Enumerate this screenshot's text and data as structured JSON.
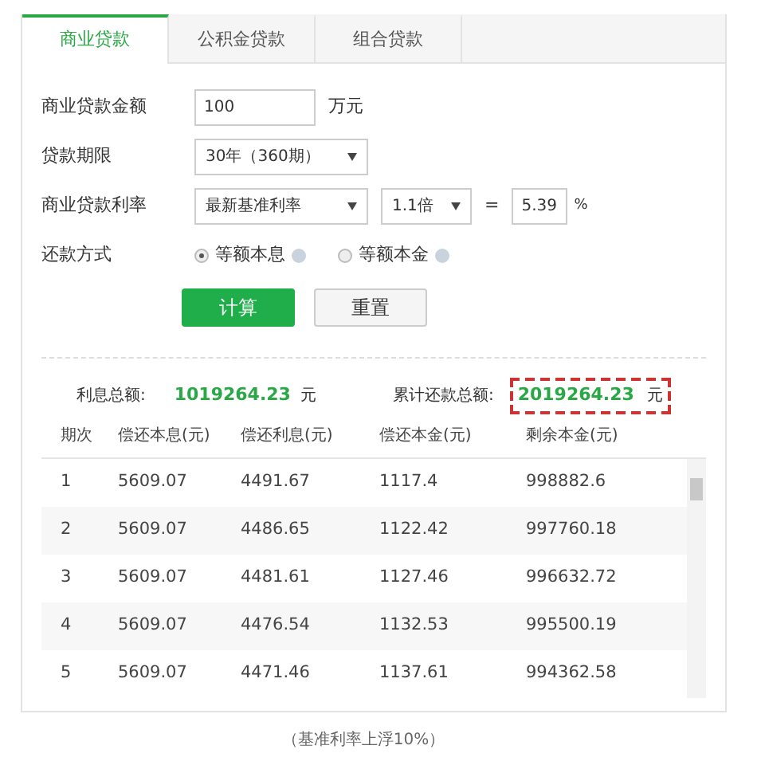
{
  "tabs": [
    {
      "label": "商业贷款",
      "selected": true
    },
    {
      "label": "公积金贷款",
      "selected": false
    },
    {
      "label": "组合贷款",
      "selected": false
    }
  ],
  "form": {
    "amount": {
      "label": "商业贷款金额",
      "value": "100",
      "unit": "万元"
    },
    "term": {
      "label": "贷款期限",
      "value": "30年（360期）"
    },
    "rate": {
      "label": "商业贷款利率",
      "base": "最新基准利率",
      "multiplier": "1.1倍",
      "equals": "=",
      "value": "5.39",
      "unit": "%"
    },
    "method": {
      "label": "还款方式",
      "options": [
        {
          "label": "等额本息",
          "selected": true
        },
        {
          "label": "等额本金",
          "selected": false
        }
      ]
    }
  },
  "buttons": [
    {
      "label": "计算",
      "kind": "primary"
    },
    {
      "label": "重置",
      "kind": "secondary"
    }
  ],
  "summary": {
    "interest_label": "利息总额:",
    "interest_value": "1019264.23",
    "interest_unit": "元",
    "total_label": "累计还款总额:",
    "total_value": "2019264.23",
    "total_unit": "元",
    "total_highlighted": true
  },
  "table": {
    "columns": [
      "期次",
      "偿还本息(元)",
      "偿还利息(元)",
      "偿还本金(元)",
      "剩余本金(元)"
    ],
    "rows": [
      [
        "1",
        "5609.07",
        "4491.67",
        "1117.4",
        "998882.6"
      ],
      [
        "2",
        "5609.07",
        "4486.65",
        "1122.42",
        "997760.18"
      ],
      [
        "3",
        "5609.07",
        "4481.61",
        "1127.46",
        "996632.72"
      ],
      [
        "4",
        "5609.07",
        "4476.54",
        "1132.53",
        "995500.19"
      ],
      [
        "5",
        "5609.07",
        "4471.46",
        "1137.61",
        "994362.58"
      ]
    ]
  },
  "caption": "（基准利率上浮10%）"
}
